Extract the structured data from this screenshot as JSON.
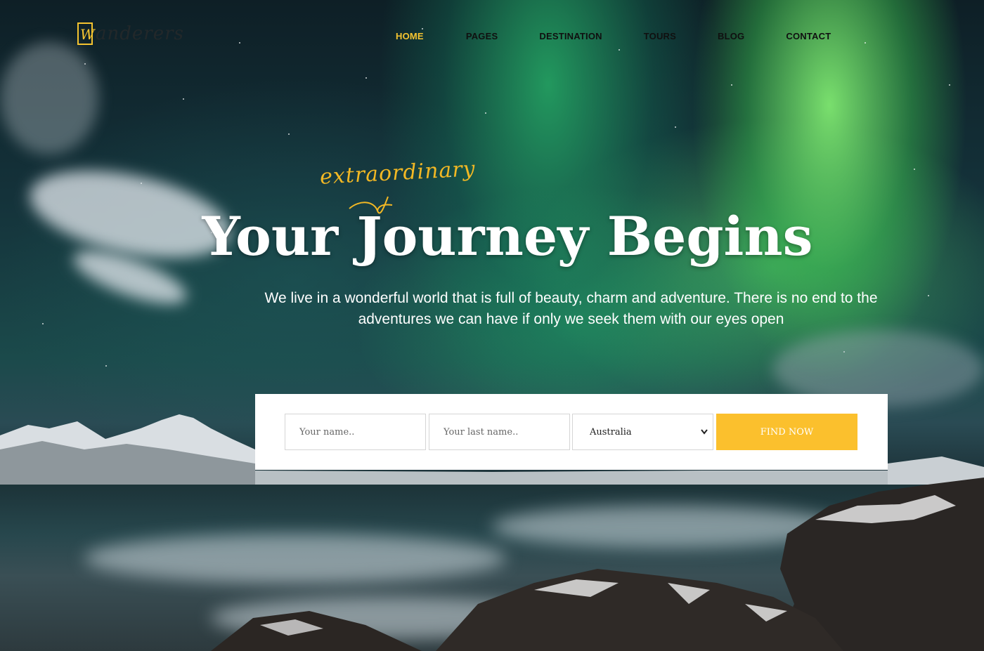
{
  "brand": {
    "logo_letter": "W",
    "name": "anderers",
    "accent_color": "#f5c430"
  },
  "nav": {
    "items": [
      {
        "label": "HOME",
        "active": true
      },
      {
        "label": "PAGES",
        "active": false
      },
      {
        "label": "DESTINATION",
        "active": false
      },
      {
        "label": "TOURS",
        "active": false
      },
      {
        "label": "BLOG",
        "active": false
      },
      {
        "label": "CONTACT",
        "active": false
      }
    ]
  },
  "hero": {
    "script_word": "extraordinary",
    "headline": "Your Journey Begins",
    "subtitle": "We live in a wonderful world that is full of beauty, charm and adventure. There is no end to the adventures we can have if only we seek them with our eyes open"
  },
  "search": {
    "first_name_placeholder": "Your name..",
    "last_name_placeholder": "Your last name..",
    "country_selected": "Australia",
    "button_label": "FIND NOW",
    "button_color": "#fbc02d"
  }
}
